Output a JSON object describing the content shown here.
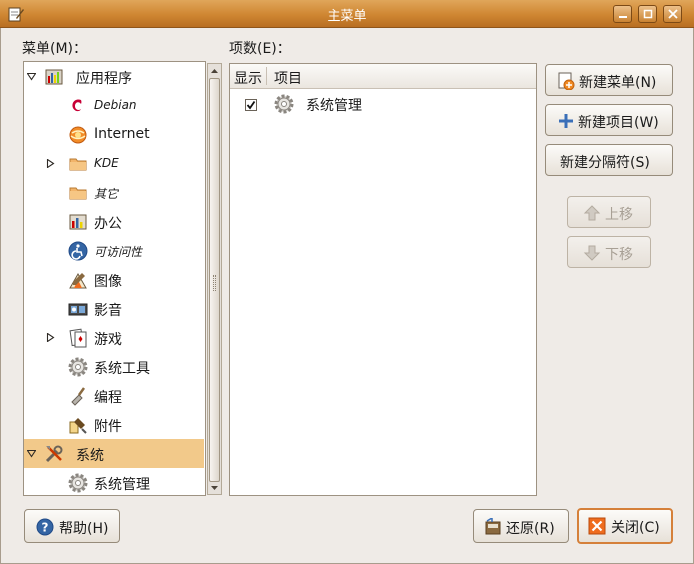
{
  "window": {
    "title": "主菜单"
  },
  "menus_label": "菜单(M)：",
  "items_label": "项数(E)：",
  "tree": [
    {
      "label": "应用程序",
      "icon": "applications-icon",
      "level": 0,
      "expander": "expanded",
      "style": "normal"
    },
    {
      "label": "Debian",
      "icon": "debian-icon",
      "level": 1,
      "expander": "none",
      "style": "small"
    },
    {
      "label": "Internet",
      "icon": "internet-globe-icon",
      "level": 1,
      "expander": "none",
      "style": "normal"
    },
    {
      "label": "KDE",
      "icon": "folder-icon",
      "level": 1,
      "expander": "collapsed",
      "style": "small"
    },
    {
      "label": "其它",
      "icon": "folder-icon",
      "level": 1,
      "expander": "none",
      "style": "small"
    },
    {
      "label": "办公",
      "icon": "office-chart-icon",
      "level": 1,
      "expander": "none",
      "style": "normal"
    },
    {
      "label": "可访问性",
      "icon": "accessibility-icon",
      "level": 1,
      "expander": "none",
      "style": "small"
    },
    {
      "label": "图像",
      "icon": "graphics-icon",
      "level": 1,
      "expander": "none",
      "style": "normal"
    },
    {
      "label": "影音",
      "icon": "multimedia-icon",
      "level": 1,
      "expander": "none",
      "style": "normal"
    },
    {
      "label": "游戏",
      "icon": "games-cards-icon",
      "level": 1,
      "expander": "collapsed",
      "style": "normal"
    },
    {
      "label": "系统工具",
      "icon": "gear-icon",
      "level": 1,
      "expander": "none",
      "style": "normal"
    },
    {
      "label": "编程",
      "icon": "programming-trowel-icon",
      "level": 1,
      "expander": "none",
      "style": "normal"
    },
    {
      "label": "附件",
      "icon": "accessories-icon",
      "level": 1,
      "expander": "none",
      "style": "normal"
    },
    {
      "label": "系统",
      "icon": "system-tools-icon",
      "level": 0,
      "expander": "expanded",
      "style": "normal",
      "selected": true
    },
    {
      "label": "系统管理",
      "icon": "gear-icon",
      "level": 1,
      "expander": "none",
      "style": "normal"
    }
  ],
  "items_table": {
    "columns": [
      "显示",
      "项目"
    ],
    "rows": [
      {
        "show": true,
        "label": "系统管理",
        "icon": "gear-icon"
      }
    ]
  },
  "buttons": {
    "new_menu": "新建菜单(N)",
    "new_item": "新建项目(W)",
    "new_separator": "新建分隔符(S)",
    "move_up": "上移",
    "move_down": "下移",
    "help": "帮助(H)",
    "revert": "还原(R)",
    "close": "关闭(C)"
  },
  "colors": {
    "title_bar": "#cf8632",
    "selection": "#f2c98a",
    "window_bg": "#efebe7"
  }
}
